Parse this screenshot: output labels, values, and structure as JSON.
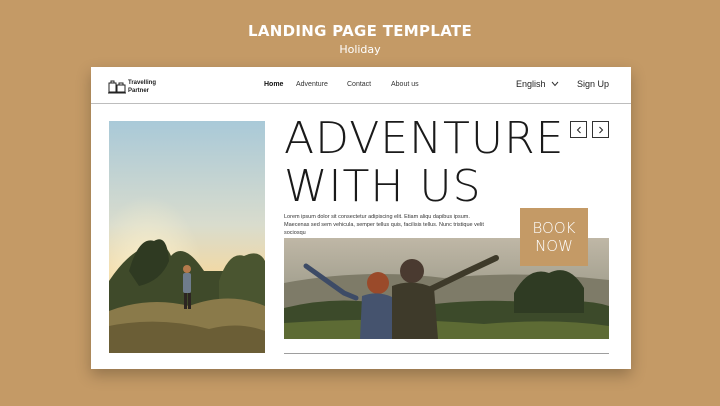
{
  "header": {
    "title": "LANDING PAGE TEMPLATE",
    "subtitle": "Holiday"
  },
  "nav": {
    "logo_line1": "Travelling",
    "logo_line2": "Partner",
    "links": [
      "Home",
      "Adventure",
      "Contact",
      "About us"
    ],
    "active": "Home",
    "language": "English",
    "signup": "Sign Up"
  },
  "hero": {
    "title_line1": "ADVENTURE",
    "title_line2": "WITH US",
    "body": "Lorem ipsum dolor sit consectetur adipiscing elit. Etiam aliqu dapibus ipsum. Maecenas sed sem vehicula, semper tellus quis, facilisis tellus. Nunc tristique velit sociosqu",
    "book_line1": "BOOK",
    "book_line2": "NOW"
  },
  "colors": {
    "background": "#c49a66",
    "accent": "#c49a66",
    "card": "#ffffff",
    "text": "#1a1a1a"
  },
  "icons": [
    "luggage-logo-icon",
    "chevron-down-icon",
    "arrow-left-icon",
    "arrow-right-icon"
  ]
}
